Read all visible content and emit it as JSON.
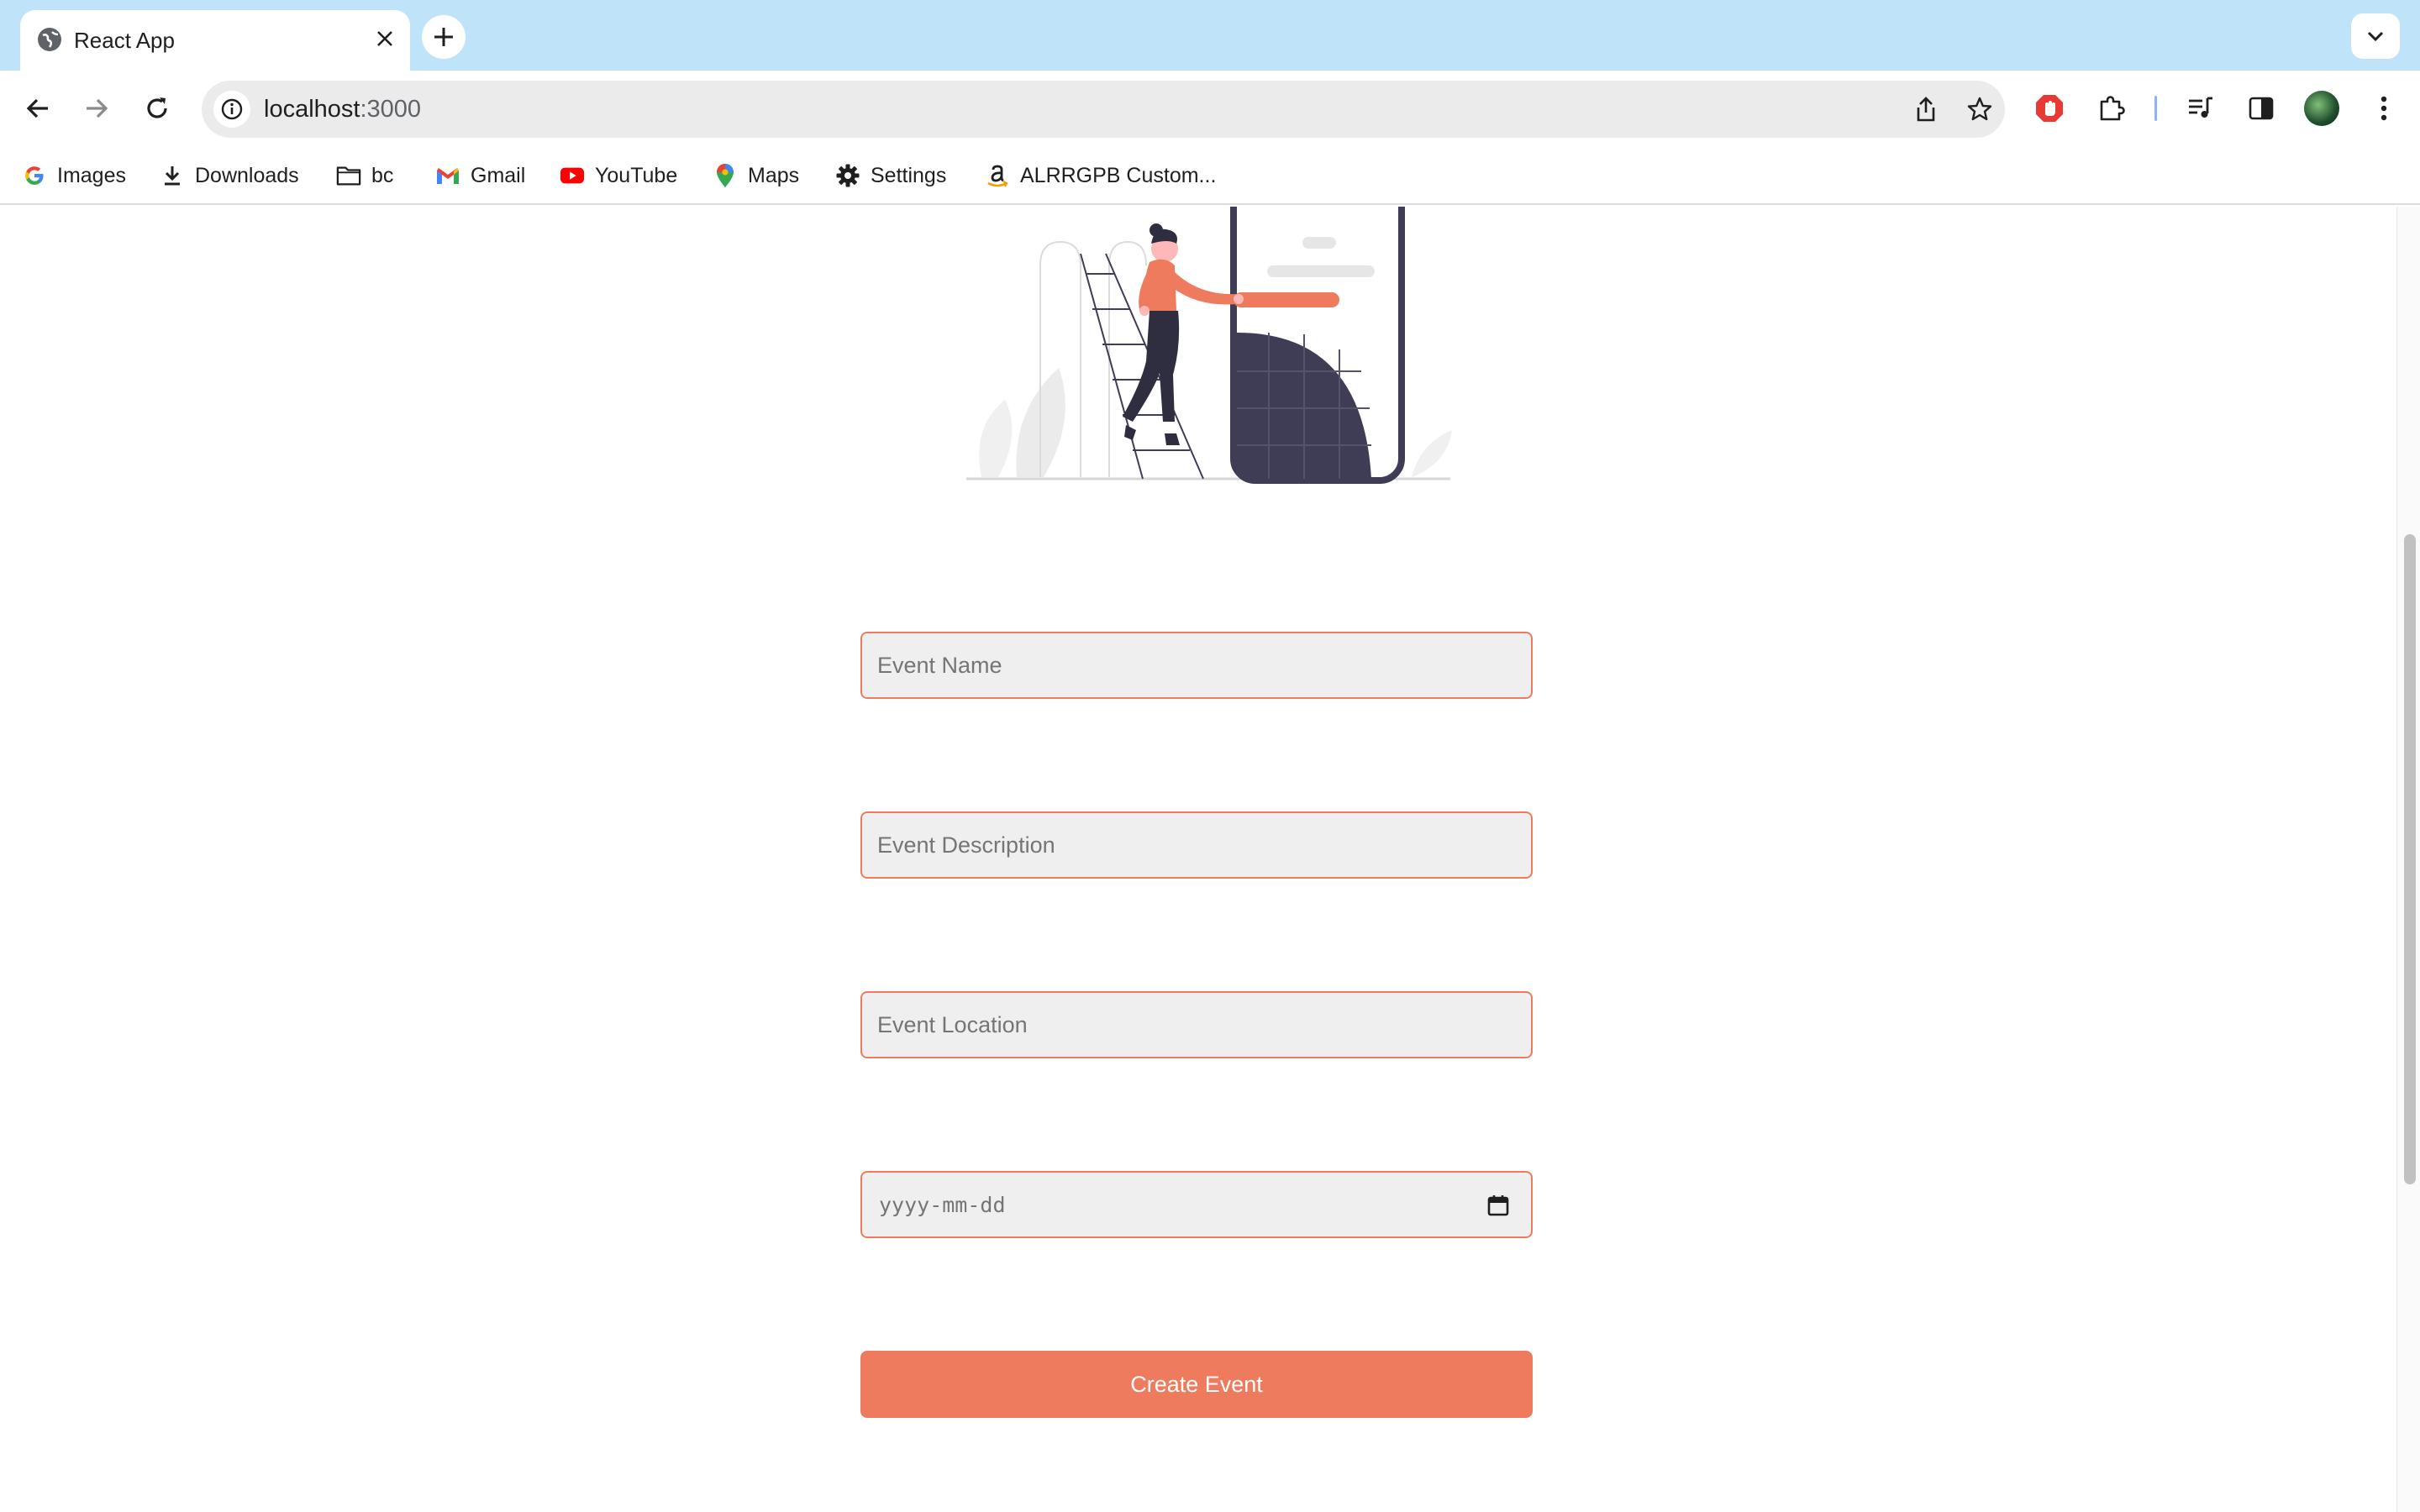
{
  "browser": {
    "tab": {
      "title": "React App"
    },
    "address": {
      "host": "localhost",
      "port": ":3000"
    },
    "bookmarks": [
      {
        "label": "Images",
        "icon": "google-icon"
      },
      {
        "label": "Downloads",
        "icon": "download-icon"
      },
      {
        "label": "bc",
        "icon": "folder-icon"
      },
      {
        "label": "Gmail",
        "icon": "gmail-icon"
      },
      {
        "label": "YouTube",
        "icon": "youtube-icon"
      },
      {
        "label": "Maps",
        "icon": "maps-icon"
      },
      {
        "label": "Settings",
        "icon": "gear-icon"
      },
      {
        "label": "ALRRGPB Custom...",
        "icon": "amazon-icon"
      }
    ]
  },
  "form": {
    "event_name": {
      "placeholder": "Event Name",
      "value": ""
    },
    "event_description": {
      "placeholder": "Event Description",
      "value": ""
    },
    "event_location": {
      "placeholder": "Event Location",
      "value": ""
    },
    "event_date": {
      "placeholder": "yyyy-mm-dd"
    },
    "submit_label": "Create Event"
  },
  "colors": {
    "accent": "#ef7b5e",
    "field_border": "#ee7b5f",
    "field_bg": "#efefef",
    "tabstrip": "#bfe3f9",
    "illustration_dark": "#3f3d56"
  }
}
